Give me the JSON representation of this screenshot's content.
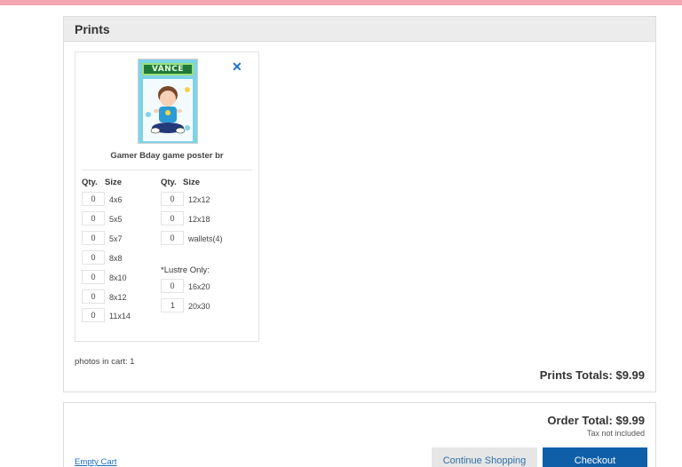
{
  "prints": {
    "title": "Prints",
    "item": {
      "name": "Gamer Bday game poster br",
      "thumb_text": "VANCE",
      "qty_header": "Qty.",
      "size_header": "Size",
      "left_sizes": [
        {
          "qty": "0",
          "size": "4x6"
        },
        {
          "qty": "0",
          "size": "5x5"
        },
        {
          "qty": "0",
          "size": "5x7"
        },
        {
          "qty": "0",
          "size": "8x8"
        },
        {
          "qty": "0",
          "size": "8x10"
        },
        {
          "qty": "0",
          "size": "8x12"
        },
        {
          "qty": "0",
          "size": "11x14"
        }
      ],
      "right_sizes": [
        {
          "qty": "0",
          "size": "12x12"
        },
        {
          "qty": "0",
          "size": "12x18"
        },
        {
          "qty": "0",
          "size": "wallets(4)"
        }
      ],
      "lustre_label": "*Lustre Only:",
      "lustre_sizes": [
        {
          "qty": "0",
          "size": "16x20"
        },
        {
          "qty": "1",
          "size": "20x30"
        }
      ]
    },
    "photos_in_cart": "photos in cart: 1",
    "totals": "Prints Totals: $9.99"
  },
  "order": {
    "total": "Order Total: $9.99",
    "tax_note": "Tax not included",
    "empty_cart": "Empty Cart",
    "continue_label": "Continue Shopping",
    "checkout_label": "Checkout"
  },
  "colors": {
    "accent_blue": "#0f5fa8",
    "link_blue": "#1a6fbf",
    "top_bar_pink": "#f4a7b3"
  },
  "icons": {
    "remove": "close-icon"
  }
}
